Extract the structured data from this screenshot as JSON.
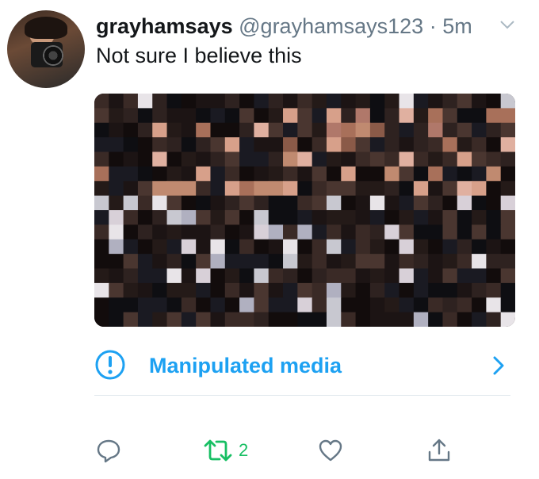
{
  "tweet": {
    "display_name": "grayhamsays",
    "handle": "@grayhamsays123",
    "separator": "·",
    "time": "5m",
    "text": "Not sure I believe this"
  },
  "notice": {
    "label": "Manipulated media"
  },
  "actions": {
    "retweet_count": "2"
  },
  "colors": {
    "accent": "#1da1f2",
    "retweet_active": "#17bf63",
    "muted": "#657786",
    "divider": "#e1e8ed"
  },
  "icons": [
    "chevron-down-icon",
    "alert-circle-icon",
    "chevron-right-icon",
    "reply-icon",
    "retweet-icon",
    "like-icon",
    "share-icon"
  ]
}
